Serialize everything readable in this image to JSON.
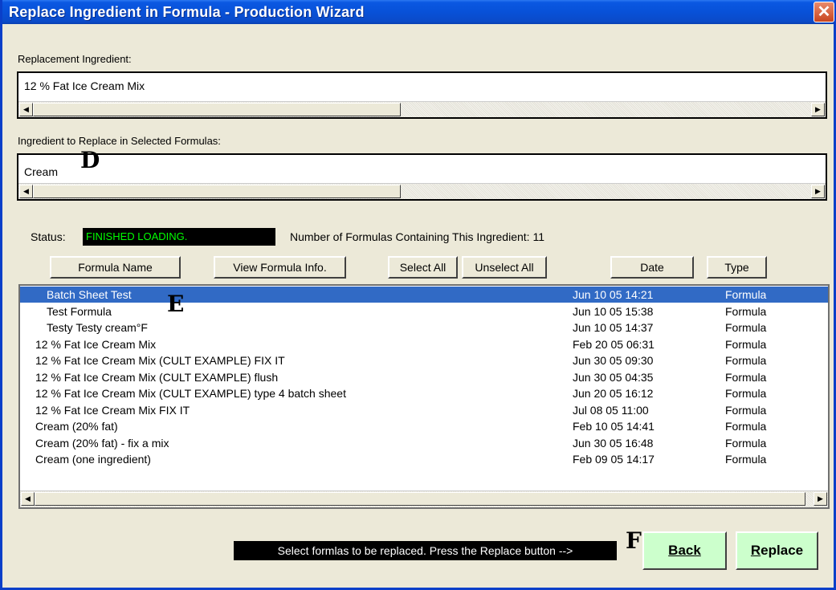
{
  "window": {
    "title": "Replace Ingredient in Formula - Production Wizard",
    "close_glyph": "✕"
  },
  "replacement": {
    "label": "Replacement Ingredient:",
    "value": "12 % Fat Ice Cream Mix"
  },
  "to_replace": {
    "label": "Ingredient to Replace in Selected Formulas:",
    "value": "Cream"
  },
  "status": {
    "label": "Status:",
    "value": "FINISHED LOADING.",
    "count_text": "Number of Formulas Containing This Ingredient: 11"
  },
  "buttons": {
    "formula_name": "Formula Name",
    "view_info": "View Formula Info.",
    "select_all": "Select All",
    "unselect_all": "Unselect All",
    "date": "Date",
    "type": "Type"
  },
  "formulas": [
    {
      "name": "Batch Sheet Test",
      "date": "Jun 10 05  14:21",
      "type": "Formula",
      "indent": true,
      "selected": true
    },
    {
      "name": "Test Formula",
      "date": "Jun 10 05  15:38",
      "type": "Formula",
      "indent": true
    },
    {
      "name": "Testy Testy cream°F",
      "date": "Jun 10 05  14:37",
      "type": "Formula",
      "indent": true
    },
    {
      "name": "12 % Fat Ice Cream Mix",
      "date": "Feb 20 05  06:31",
      "type": "Formula"
    },
    {
      "name": "12 % Fat Ice Cream Mix (CULT EXAMPLE) FIX IT",
      "date": "Jun 30 05  09:30",
      "type": "Formula"
    },
    {
      "name": "12 % Fat Ice Cream Mix (CULT EXAMPLE) flush",
      "date": "Jun 30 05  04:35",
      "type": "Formula"
    },
    {
      "name": "12 % Fat Ice Cream Mix (CULT EXAMPLE) type 4 batch sheet",
      "date": "Jun 20 05  16:12",
      "type": "Formula"
    },
    {
      "name": "12 % Fat Ice Cream Mix FIX IT",
      "date": "Jul 08 05  11:00",
      "type": "Formula"
    },
    {
      "name": "Cream (20% fat)",
      "date": "Feb 10 05  14:41",
      "type": "Formula"
    },
    {
      "name": "Cream (20% fat) - fix a mix",
      "date": "Jun 30 05  16:48",
      "type": "Formula"
    },
    {
      "name": "Cream (one ingredient)",
      "date": "Feb 09 05  14:17",
      "type": "Formula"
    }
  ],
  "footer": {
    "hint": "Select formlas to be replaced. Press the Replace button -->",
    "back_label": "Back",
    "replace_accel": "R",
    "replace_rest": "eplace"
  },
  "markers": {
    "d": "D",
    "e": "E",
    "f": "F"
  },
  "icons": {
    "scroll_left": "◀",
    "scroll_right": "▶"
  }
}
